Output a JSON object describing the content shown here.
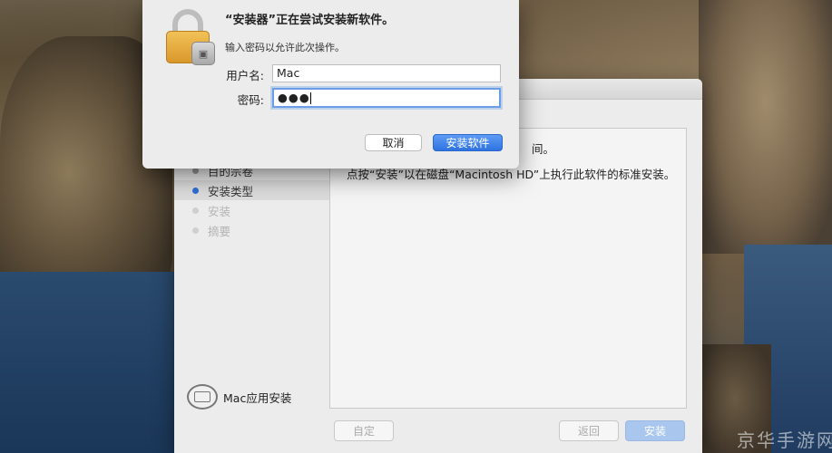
{
  "auth_dialog": {
    "title": "“安装器”正在尝试安装新软件。",
    "subtitle": "输入密码以允许此次操作。",
    "username_label": "用户名:",
    "username_value": "Mac",
    "password_label": "密码:",
    "password_masked": "●●●",
    "cancel_label": "取消",
    "install_label": "安装软件",
    "icon": "lock-icon"
  },
  "installer": {
    "steps": [
      {
        "label": "目的宗卷",
        "state": "done"
      },
      {
        "label": "安装类型",
        "state": "active"
      },
      {
        "label": "安装",
        "state": "disabled"
      },
      {
        "label": "摘要",
        "state": "disabled"
      }
    ],
    "content_line1": "间。",
    "content_line2": "点按“安装”以在磁盘“Macintosh HD”上执行此软件的标准安装。",
    "disk_label": "Mac应用安装",
    "customize_label": "自定",
    "back_label": "返回",
    "install_label": "安装"
  },
  "watermark": "京华手游网",
  "colors": {
    "accent": "#2e73e0",
    "active_step_dot": "#2d6fd6"
  }
}
